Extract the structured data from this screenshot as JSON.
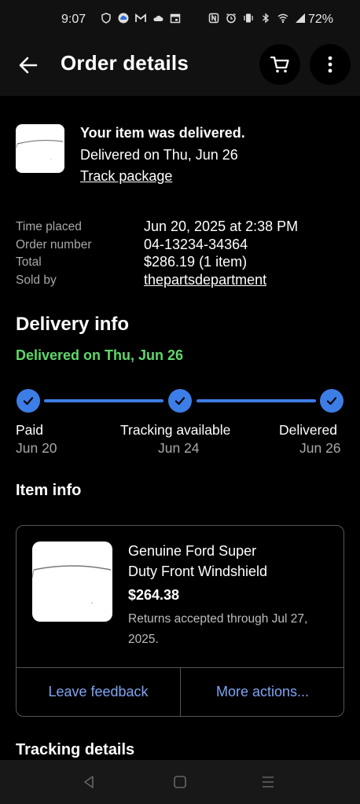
{
  "status_bar": {
    "time": "9:07",
    "battery": "72%"
  },
  "header": {
    "title": "Order details",
    "back_icon": "arrow-left-icon",
    "cart_icon": "cart-icon",
    "more_icon": "more-vertical-icon"
  },
  "delivery_summary": {
    "title": "Your item was delivered.",
    "date": "Delivered on Thu, Jun 26",
    "track_link": "Track package"
  },
  "order_meta": [
    {
      "label": "Time placed",
      "value": "Jun 20, 2025 at 2:38 PM"
    },
    {
      "label": "Order number",
      "value": "04-13234-34364"
    },
    {
      "label": "Total",
      "value": "$286.19 (1 item)"
    },
    {
      "label": "Sold by",
      "value": "thepartsdepartment"
    }
  ],
  "delivery_info": {
    "heading": "Delivery info",
    "status": "Delivered on Thu, Jun 26",
    "steps": [
      {
        "label": "Paid",
        "date": "Jun 20"
      },
      {
        "label": "Tracking available",
        "date": "Jun 24"
      },
      {
        "label": "Delivered",
        "date": "Jun 26"
      }
    ]
  },
  "item_info": {
    "heading": "Item info",
    "title_line1": "Genuine Ford Super",
    "title_line2": "Duty Front Windshield",
    "price": "$264.38",
    "returns_line1": "Returns accepted through Jul 27,",
    "returns_line2": "2025.",
    "actions": {
      "feedback": "Leave feedback",
      "more": "More actions..."
    }
  },
  "tracking": {
    "heading": "Tracking details"
  },
  "colors": {
    "accent_blue": "#3d7de6",
    "link_blue": "#7ea6f2",
    "success_green": "#5fd86a",
    "background": "#000000"
  }
}
